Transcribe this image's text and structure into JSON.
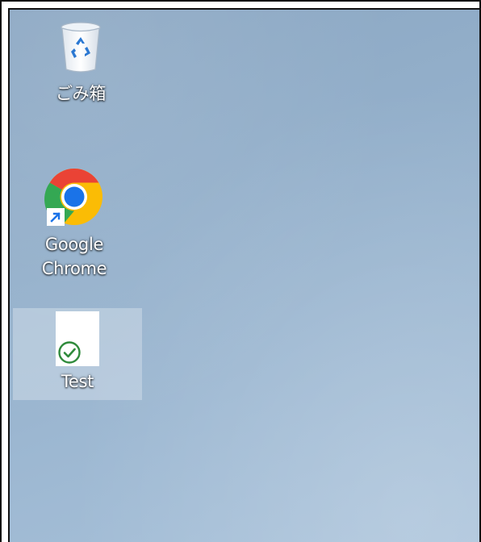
{
  "desktop": {
    "icons": [
      {
        "label": "ごみ箱",
        "icon": "recycle-bin-icon",
        "selected": false
      },
      {
        "label": "Google\nChrome",
        "icon": "chrome-icon",
        "shortcut": true,
        "selected": false
      },
      {
        "label": "Test",
        "icon": "document-icon",
        "badge": "sync-check-icon",
        "selected": true
      }
    ],
    "colors": {
      "background": "#9db8d2",
      "selection": "#cddae8",
      "label_text": "#ffffff",
      "check_badge": "#2f8a3b",
      "shortcut_arrow": "#1a73e8"
    }
  }
}
